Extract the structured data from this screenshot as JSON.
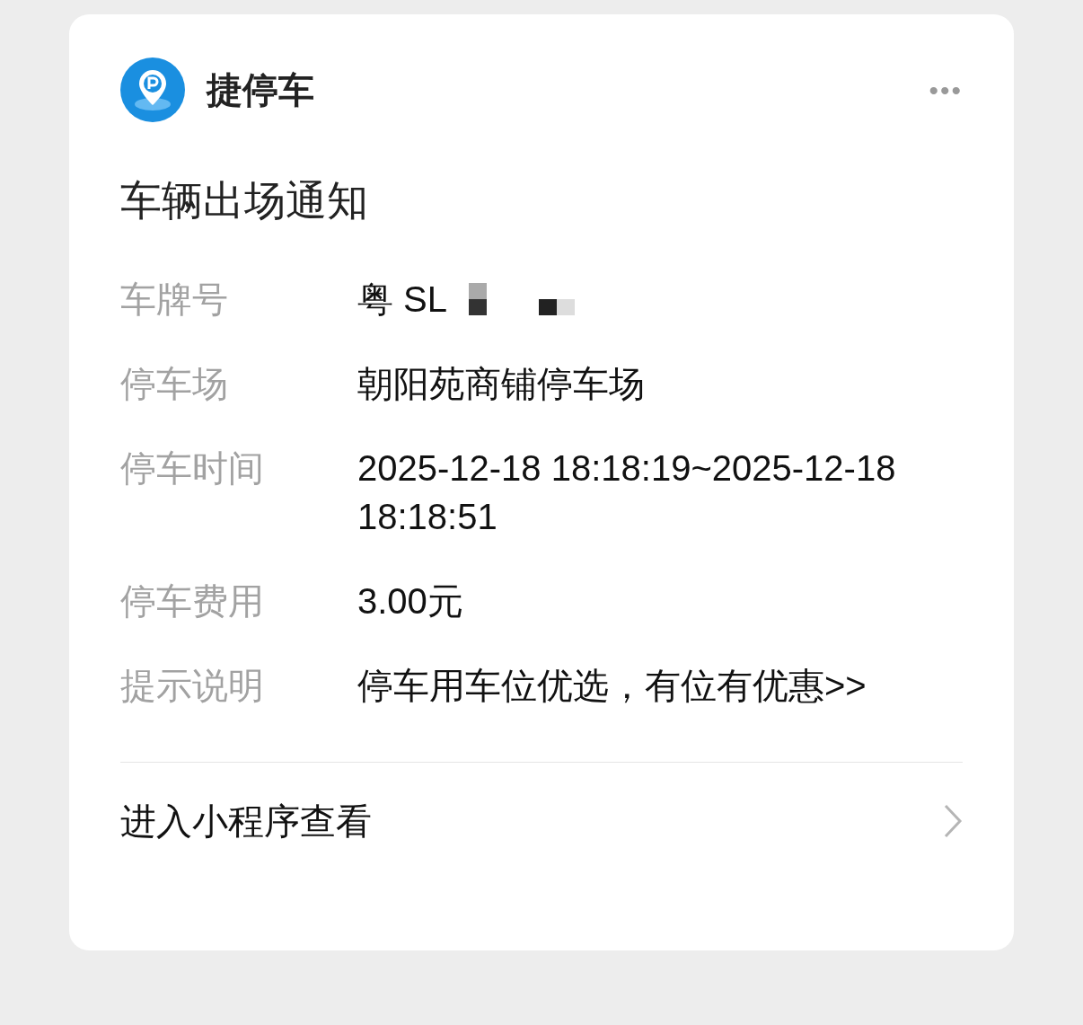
{
  "header": {
    "app_name": "捷停车",
    "more": "•••"
  },
  "title": "车辆出场通知",
  "fields": [
    {
      "label": "车牌号",
      "value": "粤 SL",
      "kind": "plate"
    },
    {
      "label": "停车场",
      "value": "朝阳苑商铺停车场",
      "kind": "text"
    },
    {
      "label": "停车时间",
      "value": "2025-12-18 18:18:19~2025-12-18 18:18:51",
      "kind": "text"
    },
    {
      "label": "停车费用",
      "value": "3.00元",
      "kind": "text"
    },
    {
      "label": "提示说明",
      "value": "停车用车位优选，有位有优惠>>",
      "kind": "text"
    }
  ],
  "footer": {
    "link": "进入小程序查看"
  }
}
